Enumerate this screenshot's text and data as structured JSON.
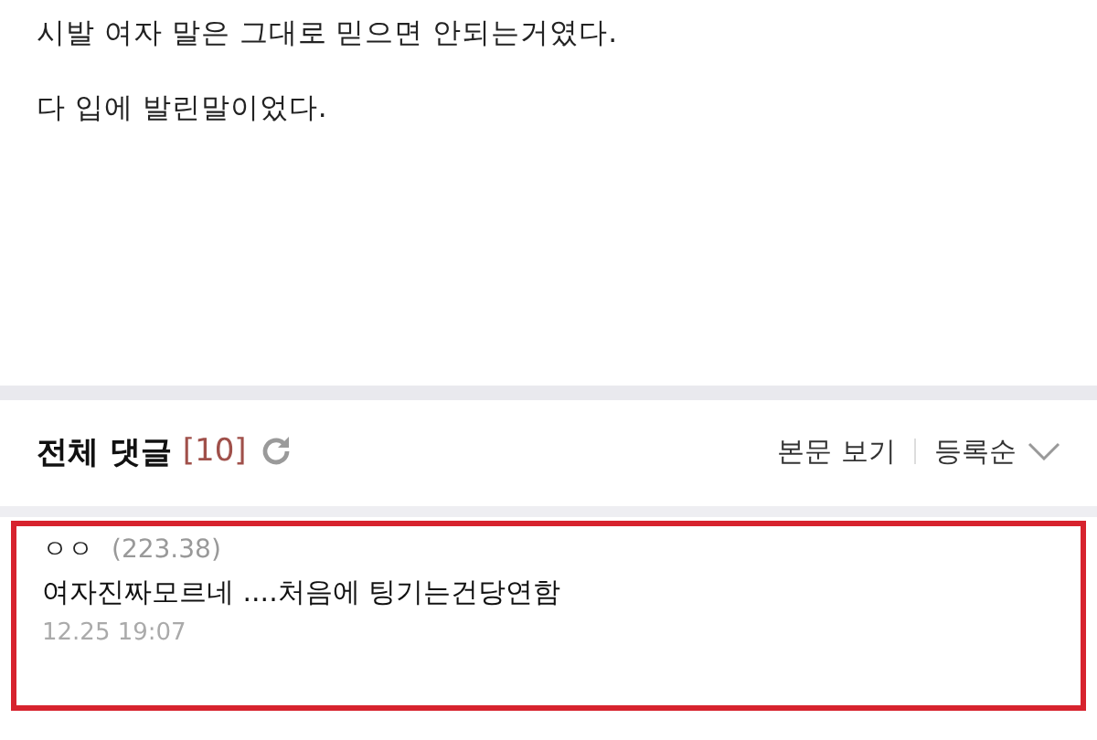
{
  "post": {
    "lines": [
      "시발 여자 말은 그대로 믿으면 안되는거였다.",
      "다 입에 발린말이었다."
    ]
  },
  "comments_header": {
    "title": "전체 댓글",
    "count": "[10]",
    "view_post": "본문 보기",
    "sort": "등록순"
  },
  "comments": [
    {
      "author": "ㅇㅇ",
      "ip": "(223.38)",
      "text": "여자진짜모르네 ....처음에 팅기는건당연함",
      "time": "12.25 19:07",
      "highlighted": true
    }
  ]
}
